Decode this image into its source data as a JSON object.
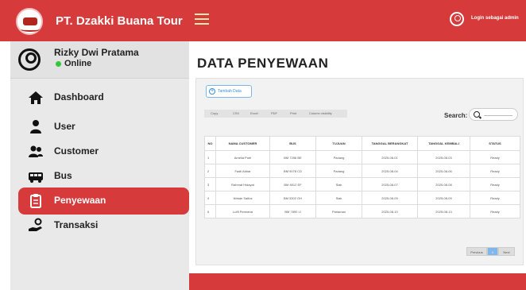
{
  "header": {
    "brand": "PT. Dzakki Buana Tour",
    "login_text": "Login sebagai admin"
  },
  "sidebar": {
    "user_name": "Rizky Dwi Pratama",
    "status": "Online",
    "items": [
      {
        "label": "Dashboard",
        "icon": "home-icon"
      },
      {
        "label": "User",
        "icon": "user-icon"
      },
      {
        "label": "Customer",
        "icon": "users-icon"
      },
      {
        "label": "Bus",
        "icon": "bus-icon"
      },
      {
        "label": "Penyewaan",
        "icon": "clipboard-icon",
        "active": true
      },
      {
        "label": "Transaksi",
        "icon": "hand-coin-icon"
      }
    ]
  },
  "main": {
    "title": "DATA PENYEWAAN",
    "add_button": "Tambah Data",
    "export_buttons": [
      "Copy",
      "CSV",
      "Excel",
      "PDF",
      "Print",
      "Column visibility"
    ],
    "search_label": "Search:",
    "table": {
      "headers": [
        "NO",
        "NAMA CUSTOMER",
        "BUS",
        "TUJUAN",
        "TANGGAL BERANGKAT",
        "TANGGAL KEMBALI",
        "STATUS"
      ],
      "rows": [
        [
          "1",
          "Amelia Putri",
          "BM 7256 BE",
          "Padang",
          "2025-08-01",
          "2025-08-03",
          "Ready"
        ],
        [
          "2",
          "Fadli Akbar",
          "BM 9078 CD",
          "Padang",
          "2025-08-04",
          "2025-08-06",
          "Ready"
        ],
        [
          "3",
          "Rahmat Hidayat",
          "BM 8012 EF",
          "Siak",
          "2025-08-07",
          "2025-08-08",
          "Ready"
        ],
        [
          "4",
          "Ikhsan Saifus",
          "BM 3302 GH",
          "Siak",
          "2025-08-09",
          "2025-08-09",
          "Ready"
        ],
        [
          "5",
          "Lutfi Permana",
          "BM 7890 IJ",
          "Pariaman",
          "2025-08-10",
          "2025-08-13",
          "Ready"
        ]
      ]
    },
    "pager": {
      "prev": "Previous",
      "page": "1",
      "next": "Next"
    }
  },
  "colors": {
    "accent": "#d63a3a",
    "sidebar_bg": "#e9e9e9",
    "online": "#35c63a",
    "link_blue": "#3a8ee0"
  }
}
